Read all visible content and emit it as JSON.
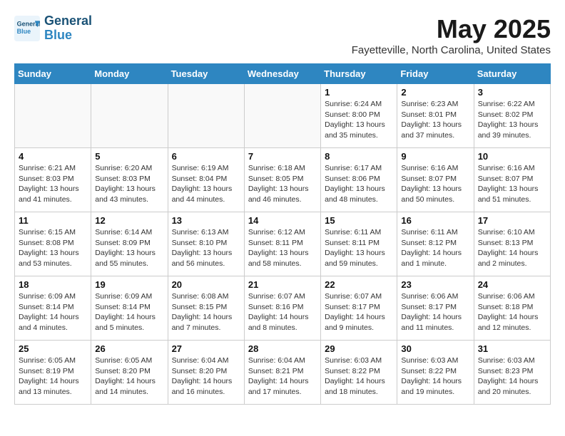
{
  "logo": {
    "line1": "General",
    "line2": "Blue"
  },
  "title": {
    "month": "May 2025",
    "location": "Fayetteville, North Carolina, United States"
  },
  "weekdays": [
    "Sunday",
    "Monday",
    "Tuesday",
    "Wednesday",
    "Thursday",
    "Friday",
    "Saturday"
  ],
  "weeks": [
    [
      {
        "day": "",
        "info": ""
      },
      {
        "day": "",
        "info": ""
      },
      {
        "day": "",
        "info": ""
      },
      {
        "day": "",
        "info": ""
      },
      {
        "day": "1",
        "info": "Sunrise: 6:24 AM\nSunset: 8:00 PM\nDaylight: 13 hours\nand 35 minutes."
      },
      {
        "day": "2",
        "info": "Sunrise: 6:23 AM\nSunset: 8:01 PM\nDaylight: 13 hours\nand 37 minutes."
      },
      {
        "day": "3",
        "info": "Sunrise: 6:22 AM\nSunset: 8:02 PM\nDaylight: 13 hours\nand 39 minutes."
      }
    ],
    [
      {
        "day": "4",
        "info": "Sunrise: 6:21 AM\nSunset: 8:03 PM\nDaylight: 13 hours\nand 41 minutes."
      },
      {
        "day": "5",
        "info": "Sunrise: 6:20 AM\nSunset: 8:03 PM\nDaylight: 13 hours\nand 43 minutes."
      },
      {
        "day": "6",
        "info": "Sunrise: 6:19 AM\nSunset: 8:04 PM\nDaylight: 13 hours\nand 44 minutes."
      },
      {
        "day": "7",
        "info": "Sunrise: 6:18 AM\nSunset: 8:05 PM\nDaylight: 13 hours\nand 46 minutes."
      },
      {
        "day": "8",
        "info": "Sunrise: 6:17 AM\nSunset: 8:06 PM\nDaylight: 13 hours\nand 48 minutes."
      },
      {
        "day": "9",
        "info": "Sunrise: 6:16 AM\nSunset: 8:07 PM\nDaylight: 13 hours\nand 50 minutes."
      },
      {
        "day": "10",
        "info": "Sunrise: 6:16 AM\nSunset: 8:07 PM\nDaylight: 13 hours\nand 51 minutes."
      }
    ],
    [
      {
        "day": "11",
        "info": "Sunrise: 6:15 AM\nSunset: 8:08 PM\nDaylight: 13 hours\nand 53 minutes."
      },
      {
        "day": "12",
        "info": "Sunrise: 6:14 AM\nSunset: 8:09 PM\nDaylight: 13 hours\nand 55 minutes."
      },
      {
        "day": "13",
        "info": "Sunrise: 6:13 AM\nSunset: 8:10 PM\nDaylight: 13 hours\nand 56 minutes."
      },
      {
        "day": "14",
        "info": "Sunrise: 6:12 AM\nSunset: 8:11 PM\nDaylight: 13 hours\nand 58 minutes."
      },
      {
        "day": "15",
        "info": "Sunrise: 6:11 AM\nSunset: 8:11 PM\nDaylight: 13 hours\nand 59 minutes."
      },
      {
        "day": "16",
        "info": "Sunrise: 6:11 AM\nSunset: 8:12 PM\nDaylight: 14 hours\nand 1 minute."
      },
      {
        "day": "17",
        "info": "Sunrise: 6:10 AM\nSunset: 8:13 PM\nDaylight: 14 hours\nand 2 minutes."
      }
    ],
    [
      {
        "day": "18",
        "info": "Sunrise: 6:09 AM\nSunset: 8:14 PM\nDaylight: 14 hours\nand 4 minutes."
      },
      {
        "day": "19",
        "info": "Sunrise: 6:09 AM\nSunset: 8:14 PM\nDaylight: 14 hours\nand 5 minutes."
      },
      {
        "day": "20",
        "info": "Sunrise: 6:08 AM\nSunset: 8:15 PM\nDaylight: 14 hours\nand 7 minutes."
      },
      {
        "day": "21",
        "info": "Sunrise: 6:07 AM\nSunset: 8:16 PM\nDaylight: 14 hours\nand 8 minutes."
      },
      {
        "day": "22",
        "info": "Sunrise: 6:07 AM\nSunset: 8:17 PM\nDaylight: 14 hours\nand 9 minutes."
      },
      {
        "day": "23",
        "info": "Sunrise: 6:06 AM\nSunset: 8:17 PM\nDaylight: 14 hours\nand 11 minutes."
      },
      {
        "day": "24",
        "info": "Sunrise: 6:06 AM\nSunset: 8:18 PM\nDaylight: 14 hours\nand 12 minutes."
      }
    ],
    [
      {
        "day": "25",
        "info": "Sunrise: 6:05 AM\nSunset: 8:19 PM\nDaylight: 14 hours\nand 13 minutes."
      },
      {
        "day": "26",
        "info": "Sunrise: 6:05 AM\nSunset: 8:20 PM\nDaylight: 14 hours\nand 14 minutes."
      },
      {
        "day": "27",
        "info": "Sunrise: 6:04 AM\nSunset: 8:20 PM\nDaylight: 14 hours\nand 16 minutes."
      },
      {
        "day": "28",
        "info": "Sunrise: 6:04 AM\nSunset: 8:21 PM\nDaylight: 14 hours\nand 17 minutes."
      },
      {
        "day": "29",
        "info": "Sunrise: 6:03 AM\nSunset: 8:22 PM\nDaylight: 14 hours\nand 18 minutes."
      },
      {
        "day": "30",
        "info": "Sunrise: 6:03 AM\nSunset: 8:22 PM\nDaylight: 14 hours\nand 19 minutes."
      },
      {
        "day": "31",
        "info": "Sunrise: 6:03 AM\nSunset: 8:23 PM\nDaylight: 14 hours\nand 20 minutes."
      }
    ]
  ]
}
